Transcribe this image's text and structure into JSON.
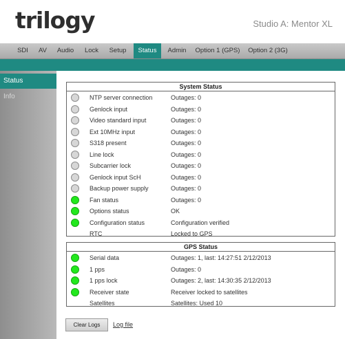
{
  "header": {
    "logo_text": "trilogy",
    "studio_title": "Studio A: Mentor XL"
  },
  "nav": {
    "items": [
      {
        "label": "SDI",
        "active": false
      },
      {
        "label": "AV",
        "active": false
      },
      {
        "label": "Audio",
        "active": false
      },
      {
        "label": "Lock",
        "active": false
      },
      {
        "label": "Setup",
        "active": false
      },
      {
        "label": "Status",
        "active": true
      },
      {
        "label": "Admin",
        "active": false
      },
      {
        "label": "Option 1 (GPS)",
        "active": false
      },
      {
        "label": "Option 2 (3G)",
        "active": false
      }
    ]
  },
  "sidebar": {
    "items": [
      {
        "label": "Status",
        "active": true
      },
      {
        "label": "Info",
        "active": false
      }
    ]
  },
  "system_status": {
    "title": "System Status",
    "rows": [
      {
        "label": "NTP server connection",
        "value": "Outages: 0",
        "indicator": "grey"
      },
      {
        "label": "Genlock input",
        "value": "Outages: 0",
        "indicator": "grey"
      },
      {
        "label": "Video standard input",
        "value": "Outages: 0",
        "indicator": "grey"
      },
      {
        "label": "Ext 10MHz input",
        "value": "Outages: 0",
        "indicator": "grey"
      },
      {
        "label": "S318 present",
        "value": "Outages: 0",
        "indicator": "grey"
      },
      {
        "label": "Line lock",
        "value": "Outages: 0",
        "indicator": "grey"
      },
      {
        "label": "Subcarrier lock",
        "value": "Outages: 0",
        "indicator": "grey"
      },
      {
        "label": "Genlock input ScH",
        "value": "Outages: 0",
        "indicator": "grey"
      },
      {
        "label": "Backup power supply",
        "value": "Outages: 0",
        "indicator": "grey"
      },
      {
        "label": "Fan status",
        "value": "Outages: 0",
        "indicator": "green"
      },
      {
        "label": "Options status",
        "value": "OK",
        "indicator": "green"
      },
      {
        "label": "Configuration status",
        "value": "Configuration verified",
        "indicator": "green"
      },
      {
        "label": "RTC",
        "value": "Locked to GPS",
        "indicator": "none"
      }
    ]
  },
  "gps_status": {
    "title": "GPS Status",
    "rows": [
      {
        "label": "Serial data",
        "value": "Outages: 1, last: 14:27:51 2/12/2013",
        "indicator": "green"
      },
      {
        "label": "1 pps",
        "value": "Outages: 0",
        "indicator": "green"
      },
      {
        "label": "1 pps lock",
        "value": "Outages: 2, last: 14:30:35 2/12/2013",
        "indicator": "green"
      },
      {
        "label": "Receiver state",
        "value": "Receiver locked to satellites",
        "indicator": "green"
      },
      {
        "label": "Satellites",
        "value": "Satellites: Used 10",
        "indicator": "none"
      }
    ]
  },
  "footer": {
    "clear_logs_label": "Clear Logs",
    "log_file_label": "Log file"
  },
  "colors": {
    "accent": "#1f8a82",
    "indicator_green": "#22e81d",
    "indicator_grey": "#d7d7d7"
  }
}
